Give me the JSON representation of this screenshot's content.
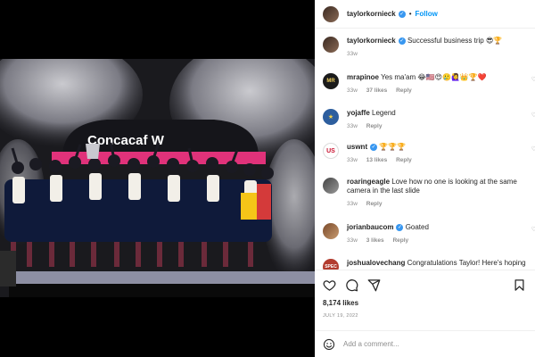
{
  "post": {
    "author": "taylorkornieck",
    "follow_label": "Follow",
    "separator": "•",
    "caption": "Successful business trip 😎🏆",
    "caption_time": "33w",
    "likes": "8,174 likes",
    "date": "JULY 19, 2022",
    "photo_banner": "Concacaf W"
  },
  "comments": [
    {
      "user": "mrapinoe",
      "verified": false,
      "text": "Yes ma'am 😂🇺🇸😍🥲🙋‍♀️👑🏆❤️",
      "time": "33w",
      "likes": "37 likes",
      "reply": "Reply"
    },
    {
      "user": "yojaffe",
      "verified": false,
      "text": "Legend",
      "time": "33w",
      "likes": "",
      "reply": "Reply"
    },
    {
      "user": "uswnt",
      "verified": true,
      "text": "🏆🏆🏆",
      "time": "33w",
      "likes": "13 likes",
      "reply": "Reply"
    },
    {
      "user": "roaringeagle",
      "verified": false,
      "text": "Love how no one is looking at the same camera in the last slide",
      "time": "33w",
      "likes": "",
      "reply": "Reply"
    },
    {
      "user": "jorianbaucom",
      "verified": true,
      "text": "Goated",
      "time": "33w",
      "likes": "3 likes",
      "reply": "Reply"
    },
    {
      "user": "joshualovechang",
      "verified": false,
      "text": "Congratulations Taylor! Here's hoping",
      "time": "",
      "likes": "",
      "reply": ""
    }
  ],
  "add_comment": {
    "placeholder": "Add a comment..."
  },
  "icons": {
    "verified": "verified-badge-icon",
    "like": "heart-icon",
    "comment": "comment-icon",
    "share": "share-icon",
    "save": "bookmark-icon",
    "emoji": "emoji-icon"
  },
  "colors": {
    "link": "#0095f6",
    "verified": "#3897f0",
    "muted": "#8e8e8e",
    "text": "#262626",
    "media_background": "#000000"
  }
}
